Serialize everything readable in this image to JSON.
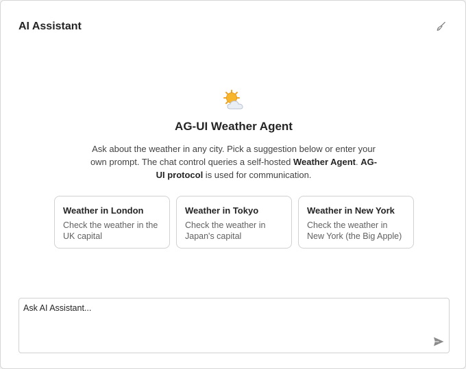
{
  "header": {
    "title": "AI Assistant",
    "clear_icon": "broom-icon"
  },
  "welcome": {
    "icon": "sun-behind-cloud-icon",
    "title": "AG-UI Weather Agent",
    "text_part1": "Ask about the weather in any city. Pick a suggestion below or enter your own prompt. The chat control queries a self-hosted ",
    "text_bold1": "Weather Agent",
    "text_part2": ". ",
    "text_bold2": "AG-UI protocol",
    "text_part3": " is used for communication."
  },
  "suggestions": [
    {
      "title": "Weather in London",
      "description": "Check the weather in the UK capital"
    },
    {
      "title": "Weather in Tokyo",
      "description": "Check the weather in Japan's capital"
    },
    {
      "title": "Weather in New York",
      "description": "Check the weather in New York (the Big Apple)"
    }
  ],
  "input": {
    "placeholder": "Ask AI Assistant...",
    "value": "",
    "send_icon": "send-icon"
  },
  "colors": {
    "sun": "#f7b52c",
    "cloud": "#e9eef5",
    "border": "#d1d1d1",
    "icon_gray": "#8a8a8a"
  }
}
